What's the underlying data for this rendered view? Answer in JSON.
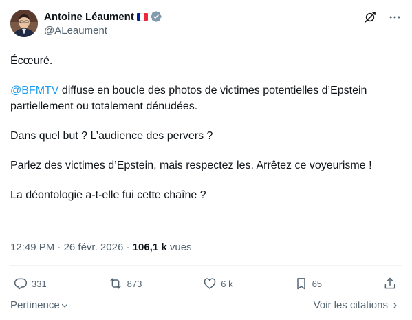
{
  "author": {
    "name": "Antoine Léaument",
    "handle": "@ALeaument",
    "flag_colors": [
      "#002395",
      "#ffffff",
      "#ed2939"
    ]
  },
  "top_icons": [
    "grok-icon",
    "more-icon"
  ],
  "tweet": {
    "line1": "Écœuré.",
    "mention": "@BFMTV",
    "line2_rest": " diffuse en boucle des photos de victimes potentielles d’Epstein partiellement ou totalement dénudées.",
    "line3": "Dans quel but ? L’audience des pervers ?",
    "line4": "Parlez des victimes d’Epstein, mais respectez les. Arrêtez ce voyeurisme !",
    "line5": "La déontologie a-t-elle fui cette chaîne ?"
  },
  "meta": {
    "time": "12:49 PM",
    "date": "26 févr. 2026",
    "separator": " · ",
    "views_count": "106,1 k",
    "views_label": " vues"
  },
  "actions": {
    "replies": "331",
    "reposts": "873",
    "likes": "6 k",
    "bookmarks": "65"
  },
  "footer": {
    "sort_label": "Pertinence",
    "quotes_label": "Voir les citations"
  },
  "colors": {
    "accent": "#1d9bf0",
    "muted": "#536471",
    "text": "#0f1419",
    "verified": "#829aab"
  }
}
